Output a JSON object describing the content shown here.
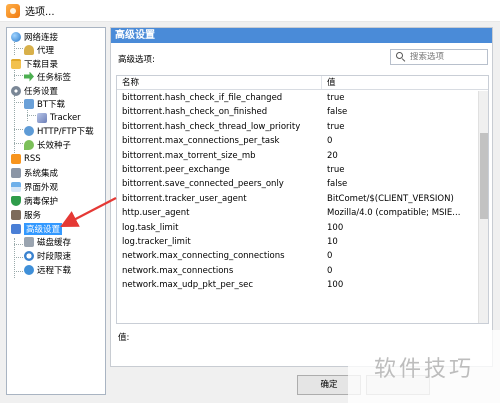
{
  "window": {
    "title": "选项..."
  },
  "tree": {
    "items": [
      {
        "label": "网络连接"
      },
      {
        "label": "代理"
      },
      {
        "label": "下载目录"
      },
      {
        "label": "任务标签"
      },
      {
        "label": "任务设置"
      },
      {
        "label": "BT下载"
      },
      {
        "label": "Tracker"
      },
      {
        "label": "HTTP/FTP下载"
      },
      {
        "label": "长效种子"
      },
      {
        "label": "RSS"
      },
      {
        "label": "系统集成"
      },
      {
        "label": "界面外观"
      },
      {
        "label": "病毒保护"
      },
      {
        "label": "服务"
      },
      {
        "label": "高级设置"
      },
      {
        "label": "磁盘缓存"
      },
      {
        "label": "时段限速"
      },
      {
        "label": "远程下载"
      }
    ]
  },
  "panel": {
    "header": "高级设置",
    "adv_label": "高级选项:",
    "search_placeholder": "搜索选项",
    "columns": {
      "name": "名称",
      "value": "值"
    },
    "rows": [
      {
        "k": "bittorrent.hash_check_if_file_changed",
        "v": "true"
      },
      {
        "k": "bittorrent.hash_check_on_finished",
        "v": "false"
      },
      {
        "k": "bittorrent.hash_check_thread_low_priority",
        "v": "true"
      },
      {
        "k": "bittorrent.max_connections_per_task",
        "v": "0"
      },
      {
        "k": "bittorrent.max_torrent_size_mb",
        "v": "20"
      },
      {
        "k": "bittorrent.peer_exchange",
        "v": "true"
      },
      {
        "k": "bittorrent.save_connected_peers_only",
        "v": "false"
      },
      {
        "k": "bittorrent.tracker_user_agent",
        "v": "BitComet/$(CLIENT_VERSION)"
      },
      {
        "k": "http.user_agent",
        "v": "Mozilla/4.0 (compatible; MSIE..."
      },
      {
        "k": "log.task_limit",
        "v": "100"
      },
      {
        "k": "log.tracker_limit",
        "v": "10"
      },
      {
        "k": "network.max_connecting_connections",
        "v": "0"
      },
      {
        "k": "network.max_connections",
        "v": "0"
      },
      {
        "k": "network.max_udp_pkt_per_sec",
        "v": "100"
      }
    ],
    "value_label": "值:"
  },
  "buttons": {
    "ok": "确定"
  },
  "watermark": "软件技巧",
  "colors": {
    "header_bg": "#4a8bd8",
    "selection": "#3399ff",
    "arrow": "#e53935"
  }
}
